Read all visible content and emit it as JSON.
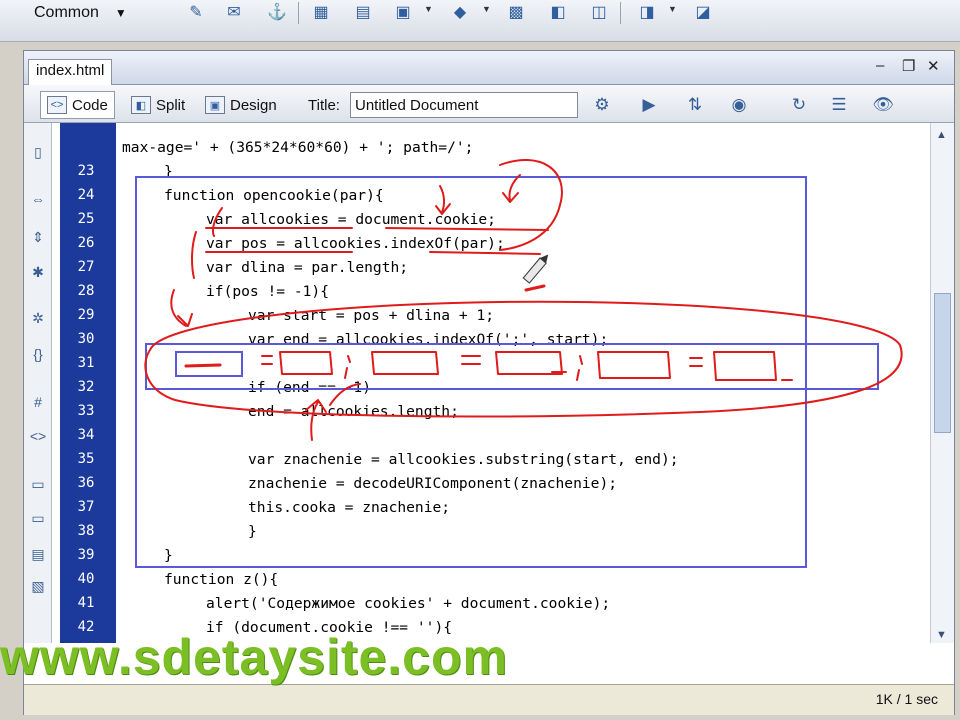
{
  "insert_bar": {
    "category": "Common"
  },
  "document": {
    "tab_name": "index.html",
    "view_buttons": {
      "code": "Code",
      "split": "Split",
      "design": "Design"
    },
    "title_label": "Title:",
    "title_value": "Untitled Document"
  },
  "code": {
    "lines": [
      {
        "num": "",
        "text": "max-age=' + (365*24*60*60) + '; path=/';"
      },
      {
        "num": "23",
        "text": "}"
      },
      {
        "num": "24",
        "text": "function opencookie(par){"
      },
      {
        "num": "25",
        "text": "var allcookies = document.cookie;"
      },
      {
        "num": "26",
        "text": "var pos = allcookies.indexOf(par);"
      },
      {
        "num": "27",
        "text": "var dlina = par.length;"
      },
      {
        "num": "28",
        "text": "if(pos != -1){"
      },
      {
        "num": "29",
        "text": "var start = pos + dlina + 1;"
      },
      {
        "num": "30",
        "text": "var end = allcookies.indexOf(';', start);"
      },
      {
        "num": "31",
        "text": ""
      },
      {
        "num": "32",
        "text": "if (end == -1)"
      },
      {
        "num": "33",
        "text": "end = allcookies.length;"
      },
      {
        "num": "34",
        "text": ""
      },
      {
        "num": "35",
        "text": "var znachenie = allcookies.substring(start, end);"
      },
      {
        "num": "36",
        "text": "znachenie = decodeURIComponent(znachenie);"
      },
      {
        "num": "37",
        "text": "this.cooka = znachenie;"
      },
      {
        "num": "38",
        "text": "}"
      },
      {
        "num": "39",
        "text": "}"
      },
      {
        "num": "40",
        "text": "function z(){"
      },
      {
        "num": "41",
        "text": "alert('Содержимое cookies' + document.cookie);"
      },
      {
        "num": "42",
        "text": "if (document.cookie !== ''){"
      }
    ]
  },
  "status": {
    "size_time": "1K / 1 sec"
  },
  "watermark": "www.sdetaysite.com",
  "colors": {
    "gutter": "#1c3a9c",
    "keyword": "#000080",
    "annotation": "#e01b1b",
    "box": "#5a5ad8",
    "watermark": "#7bbf24"
  }
}
